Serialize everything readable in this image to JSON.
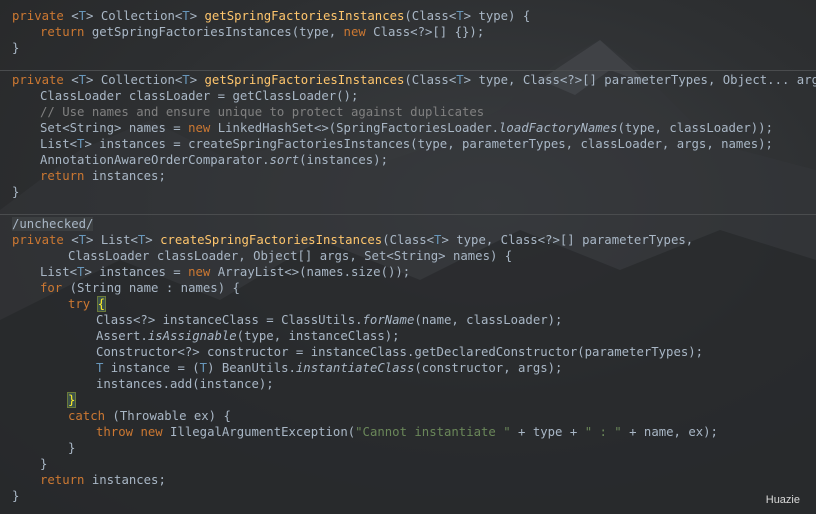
{
  "code_lines": [
    [
      {
        "t": "private",
        "c": "k"
      },
      {
        "t": " <",
        "c": ""
      },
      {
        "t": "T",
        "c": "tp"
      },
      {
        "t": "> Collection<",
        "c": ""
      },
      {
        "t": "T",
        "c": "tp"
      },
      {
        "t": "> ",
        "c": ""
      },
      {
        "t": "getSpringFactoriesInstances",
        "c": "f"
      },
      {
        "t": "(Class<",
        "c": ""
      },
      {
        "t": "T",
        "c": "tp"
      },
      {
        "t": "> type) {",
        "c": ""
      }
    ],
    [
      {
        "t": "return",
        "c": "k"
      },
      {
        "t": " getSpringFactoriesInstances(type, ",
        "c": ""
      },
      {
        "t": "new",
        "c": "k"
      },
      {
        "t": " Class<?>[] {});",
        "c": ""
      }
    ],
    [
      {
        "t": "}",
        "c": ""
      }
    ],
    [
      {
        "t": "private",
        "c": "k"
      },
      {
        "t": " <",
        "c": ""
      },
      {
        "t": "T",
        "c": "tp"
      },
      {
        "t": "> Collection<",
        "c": ""
      },
      {
        "t": "T",
        "c": "tp"
      },
      {
        "t": "> ",
        "c": ""
      },
      {
        "t": "getSpringFactoriesInstances",
        "c": "f"
      },
      {
        "t": "(Class<",
        "c": ""
      },
      {
        "t": "T",
        "c": "tp"
      },
      {
        "t": "> type, Class<?>[] parameterTypes, Object... args) {",
        "c": ""
      }
    ],
    [
      {
        "t": "ClassLoader classLoader = getClassLoader();",
        "c": ""
      }
    ],
    [
      {
        "t": "// Use names and ensure unique to protect against duplicates",
        "c": "c"
      }
    ],
    [
      {
        "t": "Set<String> names = ",
        "c": ""
      },
      {
        "t": "new",
        "c": "k"
      },
      {
        "t": " LinkedHashSet<>(SpringFactoriesLoader.",
        "c": ""
      },
      {
        "t": "loadFactoryNames",
        "c": "i"
      },
      {
        "t": "(type, classLoader));",
        "c": ""
      }
    ],
    [
      {
        "t": "List<",
        "c": ""
      },
      {
        "t": "T",
        "c": "tp"
      },
      {
        "t": "> instances = createSpringFactoriesInstances(type, parameterTypes, classLoader, args, names);",
        "c": ""
      }
    ],
    [
      {
        "t": "AnnotationAwareOrderComparator.",
        "c": ""
      },
      {
        "t": "sort",
        "c": "i"
      },
      {
        "t": "(instances);",
        "c": ""
      }
    ],
    [
      {
        "t": "return",
        "c": "k"
      },
      {
        "t": " instances;",
        "c": ""
      }
    ],
    [
      {
        "t": "}",
        "c": ""
      }
    ],
    [
      {
        "t": "/unchecked/",
        "c": "anno"
      }
    ],
    [
      {
        "t": "private",
        "c": "k"
      },
      {
        "t": " <",
        "c": ""
      },
      {
        "t": "T",
        "c": "tp"
      },
      {
        "t": "> List<",
        "c": ""
      },
      {
        "t": "T",
        "c": "tp"
      },
      {
        "t": "> ",
        "c": ""
      },
      {
        "t": "createSpringFactoriesInstances",
        "c": "f"
      },
      {
        "t": "(Class<",
        "c": ""
      },
      {
        "t": "T",
        "c": "tp"
      },
      {
        "t": "> type, Class<?>[] parameterTypes,",
        "c": ""
      }
    ],
    [
      {
        "t": "ClassLoader classLoader, Object[] args, Set<String> names) {",
        "c": ""
      }
    ],
    [
      {
        "t": "List<",
        "c": ""
      },
      {
        "t": "T",
        "c": "tp"
      },
      {
        "t": "> instances = ",
        "c": ""
      },
      {
        "t": "new",
        "c": "k"
      },
      {
        "t": " ArrayList<>(names.size());",
        "c": ""
      }
    ],
    [
      {
        "t": "for",
        "c": "k"
      },
      {
        "t": " (String name : names) {",
        "c": ""
      }
    ],
    [
      {
        "t": "try",
        "c": "k"
      },
      {
        "t": " ",
        "c": ""
      },
      {
        "t": "{",
        "c": "hl"
      }
    ],
    [
      {
        "t": "Class<?> instanceClass = ClassUtils.",
        "c": ""
      },
      {
        "t": "forName",
        "c": "i"
      },
      {
        "t": "(name, classLoader);",
        "c": ""
      }
    ],
    [
      {
        "t": "Assert.",
        "c": ""
      },
      {
        "t": "isAssignable",
        "c": "i"
      },
      {
        "t": "(type, instanceClass);",
        "c": ""
      }
    ],
    [
      {
        "t": "Constructor<?> constructor = instanceClass.getDeclaredConstructor(parameterTypes);",
        "c": ""
      }
    ],
    [
      {
        "t": "T",
        "c": "tp"
      },
      {
        "t": " instance = (",
        "c": ""
      },
      {
        "t": "T",
        "c": "tp"
      },
      {
        "t": ") BeanUtils.",
        "c": ""
      },
      {
        "t": "instantiateClass",
        "c": "i"
      },
      {
        "t": "(constructor, args);",
        "c": ""
      }
    ],
    [
      {
        "t": "instances.add(instance);",
        "c": ""
      }
    ],
    [
      {
        "t": "}",
        "c": "hl"
      }
    ],
    [
      {
        "t": "catch",
        "c": "k"
      },
      {
        "t": " (Throwable ex) {",
        "c": ""
      }
    ],
    [
      {
        "t": "throw",
        "c": "k"
      },
      {
        "t": " ",
        "c": ""
      },
      {
        "t": "new",
        "c": "k"
      },
      {
        "t": " IllegalArgumentException(",
        "c": ""
      },
      {
        "t": "\"Cannot instantiate \"",
        "c": "s"
      },
      {
        "t": " + type + ",
        "c": ""
      },
      {
        "t": "\" : \"",
        "c": "s"
      },
      {
        "t": " + name, ex);",
        "c": ""
      }
    ],
    [
      {
        "t": "}",
        "c": ""
      }
    ],
    [
      {
        "t": "}",
        "c": ""
      }
    ],
    [
      {
        "t": "return",
        "c": "k"
      },
      {
        "t": " instances;",
        "c": ""
      }
    ],
    [
      {
        "t": "}",
        "c": ""
      }
    ]
  ],
  "watermark": "Huazie",
  "colors": {
    "keyword": "#cc7832",
    "function_decl": "#ffc66d",
    "type_param": "#6897bb",
    "comment": "#808080",
    "string": "#6a8759",
    "default_text": "#a9b7c6"
  }
}
